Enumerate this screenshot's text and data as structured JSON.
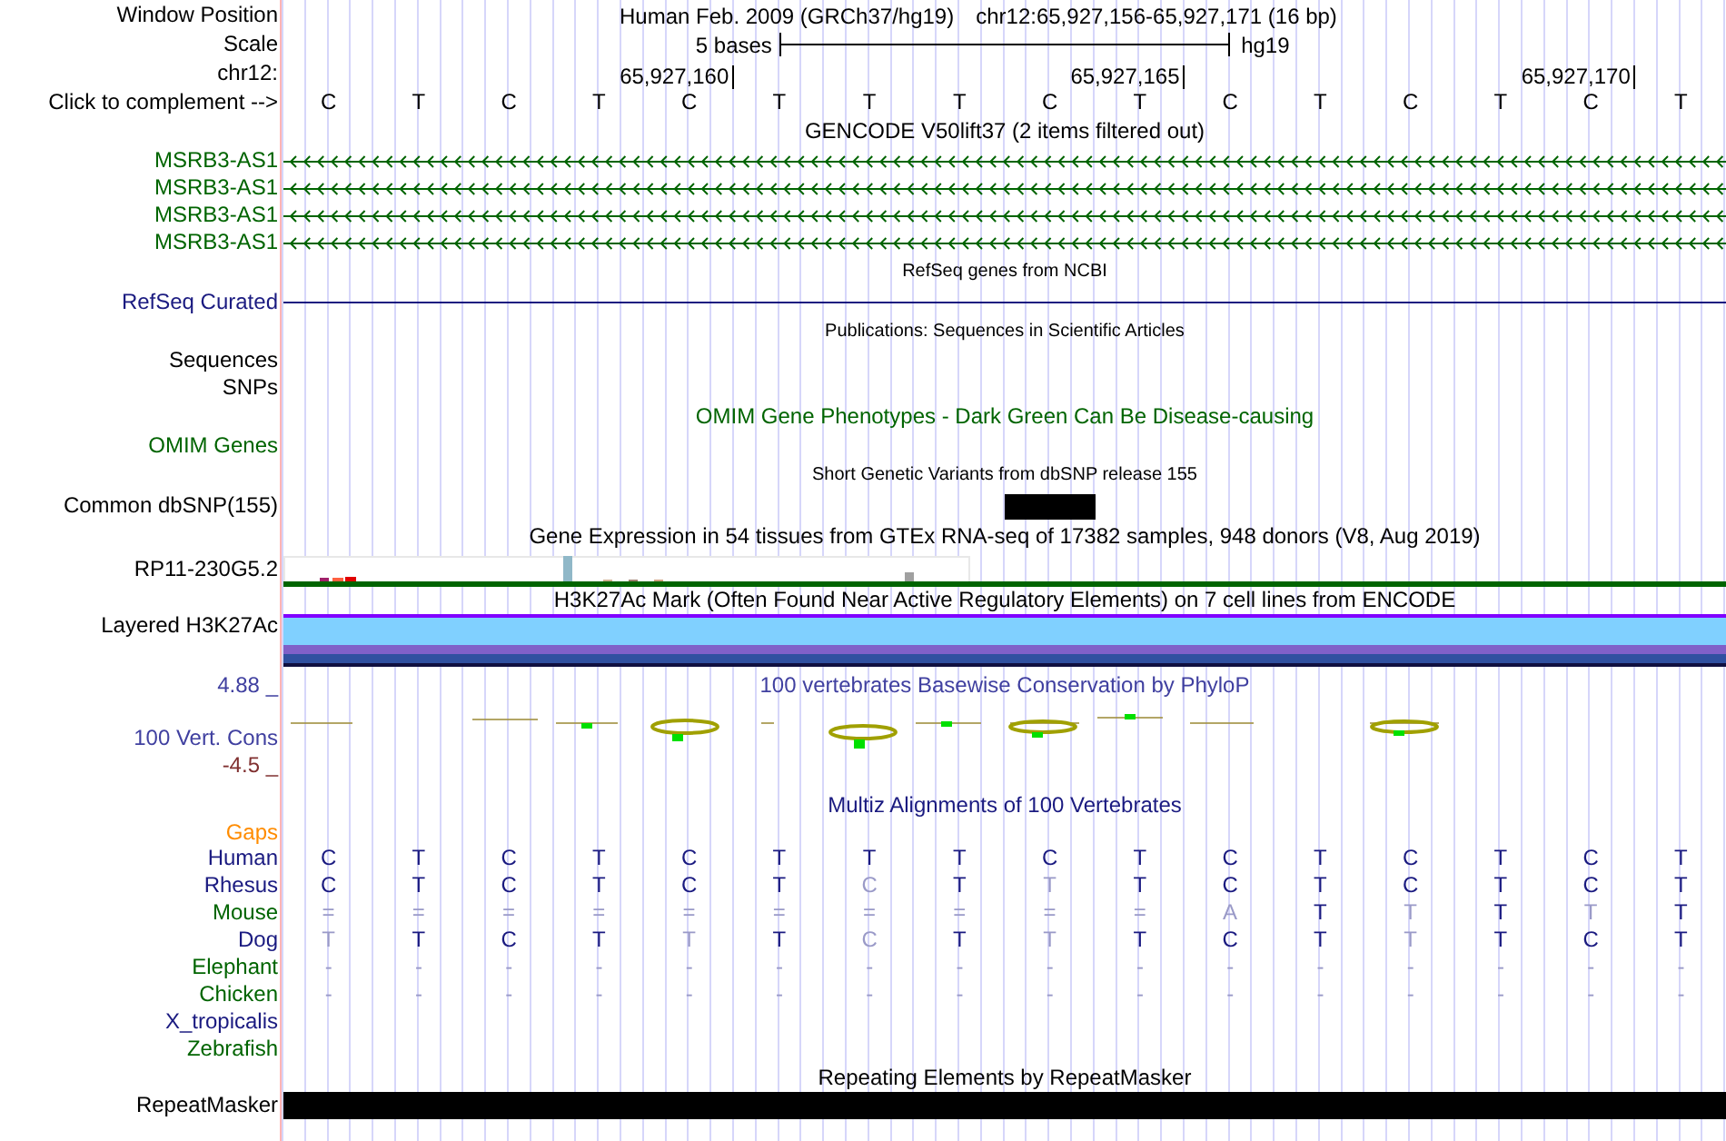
{
  "header": {
    "label": "Window Position",
    "title": "Human Feb. 2009 (GRCh37/hg19)",
    "position": "chr12:65,927,156-65,927,171 (16 bp)"
  },
  "scale": {
    "label": "Scale",
    "text": "5 bases",
    "assembly": "hg19"
  },
  "ruler": {
    "label": "chr12:",
    "ticks": [
      "65,927,160",
      "65,927,165",
      "65,927,170"
    ]
  },
  "bases": {
    "label": "Click to complement -->",
    "letters": [
      "C",
      "T",
      "C",
      "T",
      "C",
      "T",
      "T",
      "T",
      "C",
      "T",
      "C",
      "T",
      "C",
      "T",
      "C",
      "T"
    ]
  },
  "tracks": [
    {
      "kind": "gencode",
      "title": "GENCODE V50lift37 (2 items filtered out)",
      "labels": [
        "MSRB3-AS1",
        "MSRB3-AS1",
        "MSRB3-AS1",
        "MSRB3-AS1"
      ]
    },
    {
      "kind": "refseq",
      "title": "RefSeq genes from NCBI",
      "labels": [
        "RefSeq Curated"
      ]
    },
    {
      "kind": "publications",
      "title": "Publications: Sequences in Scientific Articles",
      "labels": [
        "Sequences",
        "SNPs"
      ]
    },
    {
      "kind": "omim",
      "title": "OMIM Gene Phenotypes - Dark Green Can Be Disease-causing",
      "labels": [
        "OMIM Genes"
      ]
    },
    {
      "kind": "dbsnp",
      "title": "Short Genetic Variants from dbSNP release 155",
      "labels": [
        "Common dbSNP(155)"
      ]
    },
    {
      "kind": "gtex",
      "title": "Gene Expression in 54 tissues from GTEx RNA-seq of 17382 samples, 948 donors (V8, Aug 2019)",
      "labels": [
        "RP11-230G5.2"
      ]
    },
    {
      "kind": "h3k27ac",
      "title": "H3K27Ac Mark (Often Found Near Active Regulatory Elements) on 7 cell lines from ENCODE",
      "labels": [
        "Layered H3K27Ac"
      ]
    },
    {
      "kind": "phylop",
      "title": "100 vertebrates Basewise Conservation by PhyloP",
      "labels": [
        "4.88 _",
        "100 Vert. Cons",
        "-4.5 _"
      ]
    },
    {
      "kind": "multiz",
      "title": "Multiz Alignments of 100 Vertebrates",
      "labels": [
        "Gaps"
      ],
      "species": [
        {
          "name": "Human",
          "color": "#1a1a80",
          "bases": [
            {
              "base": "C",
              "dim": false
            },
            {
              "base": "T",
              "dim": false
            },
            {
              "base": "C",
              "dim": false
            },
            {
              "base": "T",
              "dim": false
            },
            {
              "base": "C",
              "dim": false
            },
            {
              "base": "T",
              "dim": false
            },
            {
              "base": "T",
              "dim": false
            },
            {
              "base": "T",
              "dim": false
            },
            {
              "base": "C",
              "dim": false
            },
            {
              "base": "T",
              "dim": false
            },
            {
              "base": "C",
              "dim": false
            },
            {
              "base": "T",
              "dim": false
            },
            {
              "base": "C",
              "dim": false
            },
            {
              "base": "T",
              "dim": false
            },
            {
              "base": "C",
              "dim": false
            },
            {
              "base": "T",
              "dim": false
            }
          ]
        },
        {
          "name": "Rhesus",
          "color": "#1a1a80",
          "bases": [
            {
              "base": "C",
              "dim": false
            },
            {
              "base": "T",
              "dim": false
            },
            {
              "base": "C",
              "dim": false
            },
            {
              "base": "T",
              "dim": false
            },
            {
              "base": "C",
              "dim": false
            },
            {
              "base": "T",
              "dim": false
            },
            {
              "base": "C",
              "dim": true
            },
            {
              "base": "T",
              "dim": false
            },
            {
              "base": "T",
              "dim": true
            },
            {
              "base": "T",
              "dim": false
            },
            {
              "base": "C",
              "dim": false
            },
            {
              "base": "T",
              "dim": false
            },
            {
              "base": "C",
              "dim": false
            },
            {
              "base": "T",
              "dim": false
            },
            {
              "base": "C",
              "dim": false
            },
            {
              "base": "T",
              "dim": false
            }
          ]
        },
        {
          "name": "Mouse",
          "color": "#006400",
          "bases": [
            {
              "base": "=",
              "dim": true
            },
            {
              "base": "=",
              "dim": true
            },
            {
              "base": "=",
              "dim": true
            },
            {
              "base": "=",
              "dim": true
            },
            {
              "base": "=",
              "dim": true
            },
            {
              "base": "=",
              "dim": true
            },
            {
              "base": "=",
              "dim": true
            },
            {
              "base": "=",
              "dim": true
            },
            {
              "base": "=",
              "dim": true
            },
            {
              "base": "=",
              "dim": true
            },
            {
              "base": "A",
              "dim": true
            },
            {
              "base": "T",
              "dim": false
            },
            {
              "base": "T",
              "dim": true
            },
            {
              "base": "T",
              "dim": false
            },
            {
              "base": "T",
              "dim": true
            },
            {
              "base": "T",
              "dim": false
            }
          ]
        },
        {
          "name": "Dog",
          "color": "#1a1a80",
          "bases": [
            {
              "base": "T",
              "dim": true
            },
            {
              "base": "T",
              "dim": false
            },
            {
              "base": "C",
              "dim": false
            },
            {
              "base": "T",
              "dim": false
            },
            {
              "base": "T",
              "dim": true
            },
            {
              "base": "T",
              "dim": false
            },
            {
              "base": "C",
              "dim": true
            },
            {
              "base": "T",
              "dim": false
            },
            {
              "base": "T",
              "dim": true
            },
            {
              "base": "T",
              "dim": false
            },
            {
              "base": "C",
              "dim": false
            },
            {
              "base": "T",
              "dim": false
            },
            {
              "base": "T",
              "dim": true
            },
            {
              "base": "T",
              "dim": false
            },
            {
              "base": "C",
              "dim": false
            },
            {
              "base": "T",
              "dim": false
            }
          ]
        },
        {
          "name": "Elephant",
          "color": "#006400",
          "bases": [
            {
              "base": "-",
              "dim": true
            },
            {
              "base": "-",
              "dim": true
            },
            {
              "base": "-",
              "dim": true
            },
            {
              "base": "-",
              "dim": true
            },
            {
              "base": "-",
              "dim": true
            },
            {
              "base": "-",
              "dim": true
            },
            {
              "base": "-",
              "dim": true
            },
            {
              "base": "-",
              "dim": true
            },
            {
              "base": "-",
              "dim": true
            },
            {
              "base": "-",
              "dim": true
            },
            {
              "base": "-",
              "dim": true
            },
            {
              "base": "-",
              "dim": true
            },
            {
              "base": "-",
              "dim": true
            },
            {
              "base": "-",
              "dim": true
            },
            {
              "base": "-",
              "dim": true
            },
            {
              "base": "-",
              "dim": true
            }
          ]
        },
        {
          "name": "Chicken",
          "color": "#006400",
          "bases": [
            {
              "base": "-",
              "dim": true
            },
            {
              "base": "-",
              "dim": true
            },
            {
              "base": "-",
              "dim": true
            },
            {
              "base": "-",
              "dim": true
            },
            {
              "base": "-",
              "dim": true
            },
            {
              "base": "-",
              "dim": true
            },
            {
              "base": "-",
              "dim": true
            },
            {
              "base": "-",
              "dim": true
            },
            {
              "base": "-",
              "dim": true
            },
            {
              "base": "-",
              "dim": true
            },
            {
              "base": "-",
              "dim": true
            },
            {
              "base": "-",
              "dim": true
            },
            {
              "base": "-",
              "dim": true
            },
            {
              "base": "-",
              "dim": true
            },
            {
              "base": "-",
              "dim": true
            },
            {
              "base": "-",
              "dim": true
            }
          ]
        },
        {
          "name": "X_tropicalis",
          "color": "#1a1a80"
        },
        {
          "name": "Zebrafish",
          "color": "#006400"
        }
      ]
    },
    {
      "kind": "repeatmasker",
      "title": "Repeating Elements by RepeatMasker",
      "labels": [
        "RepeatMasker"
      ]
    }
  ]
}
